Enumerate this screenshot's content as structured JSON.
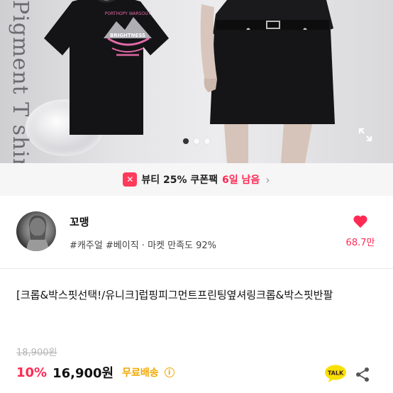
{
  "hero": {
    "vertical_text": "Pigment T shirt",
    "print_top": "PORTHOPY WARSOUT",
    "print_mid": "BRIGHTNESS",
    "carousel_dots": 3,
    "active_dot": 1
  },
  "coupon": {
    "badge": "✕",
    "text": "뷰티 25% 쿠폰팩",
    "days": "6일 남음",
    "chevron": "›"
  },
  "seller": {
    "name": "꼬맹",
    "tags": "#캐주얼 #베이직 · 마켓 만족도 92%",
    "likes": "68.7만"
  },
  "product": {
    "title": "[크롭&박스핏선택!/유니크]럽핑피그먼트프린팅옆셔링크롭&박스핏반팔",
    "original_price": "18,900원",
    "discount": "10%",
    "price": "16,900원",
    "shipping": "무료배송",
    "info": "i"
  },
  "actions": {
    "talk_label": "TALK"
  },
  "colors": {
    "accent": "#ff2a54",
    "shipping": "#f2a800",
    "talk": "#f9e000"
  }
}
